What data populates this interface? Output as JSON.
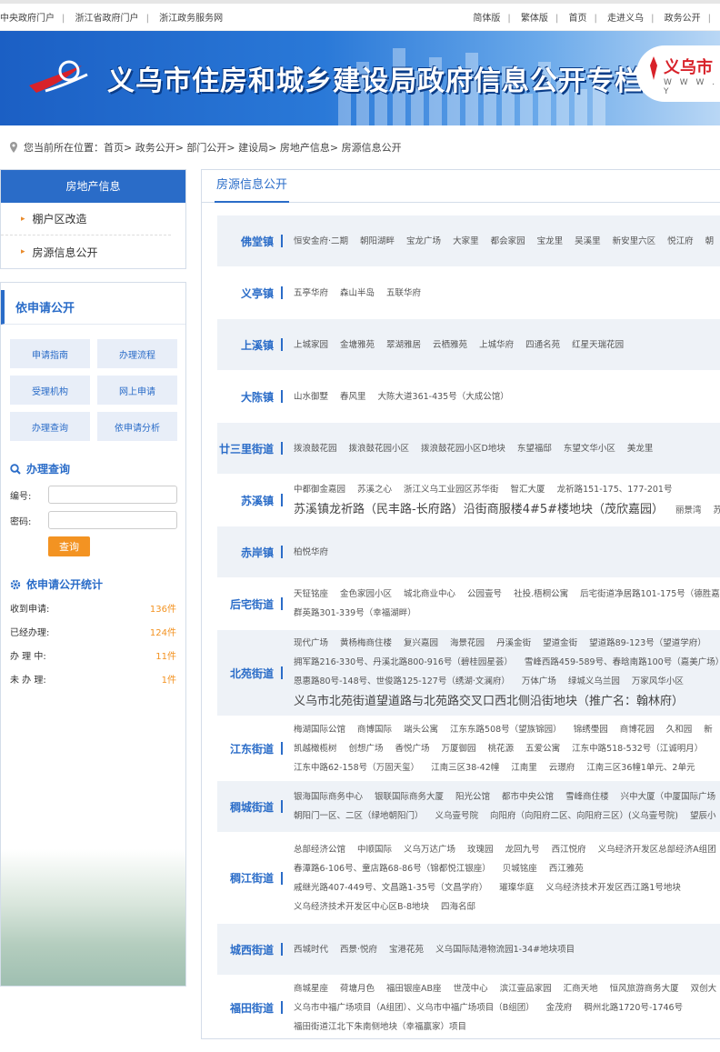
{
  "topbar": {
    "left": [
      "中央政府门户",
      "浙江省政府门户",
      "浙江政务服务网"
    ],
    "right": [
      "简体版",
      "繁体版",
      "首页",
      "走进义乌",
      "政务公开"
    ]
  },
  "banner": {
    "title": "义乌市住房和城乡建设局政府信息公开专栏",
    "brand_name": "义乌市",
    "brand_url": "W W W . Y"
  },
  "breadcrumb": {
    "prefix": "您当前所在位置：",
    "path": "首页> 政务公开> 部门公开> 建设局> 房地产信息> 房源信息公开"
  },
  "sidebar": {
    "header": "房地产信息",
    "items": [
      "棚户区改造",
      "房源信息公开"
    ],
    "apply": {
      "title": "依申请公开",
      "buttons": [
        "申请指南",
        "办理流程",
        "受理机构",
        "网上申请",
        "办理查询",
        "依申请分析"
      ]
    },
    "query": {
      "title": "办理查询",
      "number_label": "编号:",
      "password_label": "密码:",
      "button": "查询"
    },
    "stats": {
      "title": "依申请公开统计",
      "rows": [
        {
          "label": "收到申请:",
          "value": "136件"
        },
        {
          "label": "已经办理:",
          "value": "124件"
        },
        {
          "label": "办 理 中:",
          "value": "11件"
        },
        {
          "label": "未 办 理:",
          "value": "1件"
        }
      ]
    }
  },
  "main": {
    "tab": "房源信息公开",
    "towns": [
      {
        "name": "佛堂镇",
        "lines": [
          [
            "恒安金府·二期",
            "朝阳湖畔",
            "宝龙广场",
            "大家里",
            "都会家园",
            "宝龙里",
            "吴溪里",
            "新安里六区",
            "悦江府",
            "朝"
          ]
        ]
      },
      {
        "name": "义亭镇",
        "lines": [
          [
            "五亭华府",
            "森山半岛",
            "五联华府"
          ]
        ]
      },
      {
        "name": "上溪镇",
        "lines": [
          [
            "上城家园",
            "金塘雅苑",
            "翠湖雅居",
            "云栖雅苑",
            "上城华府",
            "四通名苑",
            "红星天瑞花园"
          ]
        ]
      },
      {
        "name": "大陈镇",
        "lines": [
          [
            "山水御墅",
            "春风里",
            "大陈大道361-435号（大成公馆）"
          ]
        ]
      },
      {
        "name": "廿三里街道",
        "lines": [
          [
            "拨浪鼓花园",
            "拨浪鼓花园小区",
            "拨浪鼓花园小区D地块",
            "东望福邸",
            "东望文华小区",
            "美龙里"
          ]
        ]
      },
      {
        "name": "苏溪镇",
        "lines": [
          [
            "中都御金嘉园",
            "苏溪之心",
            "浙江义乌工业园区苏华街",
            "智汇大厦",
            "龙祈路151-175、177-201号"
          ]
        ],
        "big": [
          "苏溪镇龙祈路（民丰路-长府路）沿街商服楼4#5#楼地块（茂欣嘉园）"
        ],
        "after_big": [
          "丽景湾",
          "苏溪"
        ]
      },
      {
        "name": "赤岸镇",
        "lines": [
          [
            "柏悦华府"
          ]
        ]
      },
      {
        "name": "后宅街道",
        "lines": [
          [
            "天钲铭座",
            "金色家园小区",
            "城北商业中心",
            "公园壹号",
            "社投.梧桐公寓",
            "后宅街道净居路101-175号（德胜嘉"
          ],
          [
            "群英路301-339号（幸福湖畔）"
          ]
        ]
      },
      {
        "name": "北苑街道",
        "lines": [
          [
            "现代广场",
            "黄杨梅商住楼",
            "复兴嘉园",
            "海景花园",
            "丹溪金街",
            "望道金街",
            "望道路89-123号（望道学府）"
          ],
          [
            "拥军路216-330号、丹溪北路800-916号（碧桂园星荟）",
            "雪峰西路459-589号、春晗南路100号（嘉美广场）"
          ],
          [
            "恩惠路80号-148号、世俊路125-127号（绣湖·文澜府）",
            "万体广场",
            "绿城义乌兰园",
            "万家风华小区"
          ]
        ],
        "big2": "义乌市北苑街道望道路与北苑路交叉口西北侧沿街地块（推广名：翰林府）"
      },
      {
        "name": "江东街道",
        "lines": [
          [
            "梅湖国际公馆",
            "商博国际",
            "端头公寓",
            "江东东路508号（望族锦园）",
            "锦绣璺园",
            "商博花园",
            "久和园",
            "新"
          ],
          [
            "凯越橄榄树",
            "创想广场",
            "香悦广场",
            "万厦御园",
            "桃花源",
            "五爱公寓",
            "江东中路518-532号（江诚明月）"
          ],
          [
            "江东中路62-158号（万固天玺）",
            "江南三区38-42幢",
            "江南里",
            "云璟府",
            "江南三区36幢1单元、2单元"
          ]
        ]
      },
      {
        "name": "稠城街道",
        "lines": [
          [
            "银海国际商务中心",
            "银联国际商务大厦",
            "阳光公馆",
            "都市中央公馆",
            "雪峰商住楼",
            "兴中大厦（中厦国际广场"
          ],
          [
            "朝阳门一区、二区（绿地朝阳门）",
            "义乌壹号院",
            "向阳府（向阳府二区、向阳府三区）(义乌壹号院)",
            "望辰小"
          ]
        ]
      },
      {
        "name": "稠江街道",
        "lines": [
          [
            "总部经济公馆",
            "中顺国际",
            "义乌万达广场",
            "玫瑰园",
            "龙回九号",
            "西江悦府",
            "义乌经济开发区总部经济A组团"
          ],
          [
            "春潭路6-106号、童店路68-86号（锦都悦江银座）",
            "贝城铭座",
            "西江雅苑"
          ],
          [
            "戚继光路407-449号、文昌路1-35号（文昌学府）",
            "璀璨华庭",
            "义乌经济技术开发区西江路1号地块"
          ],
          [
            "义乌经济技术开发区中心区B-8地块",
            "四海名邸"
          ]
        ]
      },
      {
        "name": "城西街道",
        "lines": [
          [
            "西城时代",
            "西景·悦府",
            "宝港花苑",
            "义乌国际陆港物流园1-34#地块项目"
          ]
        ]
      },
      {
        "name": "福田街道",
        "lines": [
          [
            "商城星座",
            "荷塘月色",
            "福田银座AB座",
            "世茂中心",
            "滨江壹品家园",
            "汇商天地",
            "恒风旅游商务大厦",
            "双创大"
          ],
          [
            "义乌市中福广场项目（A组团）、义乌市中福广场项目（B组团）",
            "金茂府",
            "稠州北路1720号-1746号"
          ],
          [
            "福田街道江北下朱南侧地块（幸福赢家）项目"
          ]
        ]
      }
    ]
  }
}
